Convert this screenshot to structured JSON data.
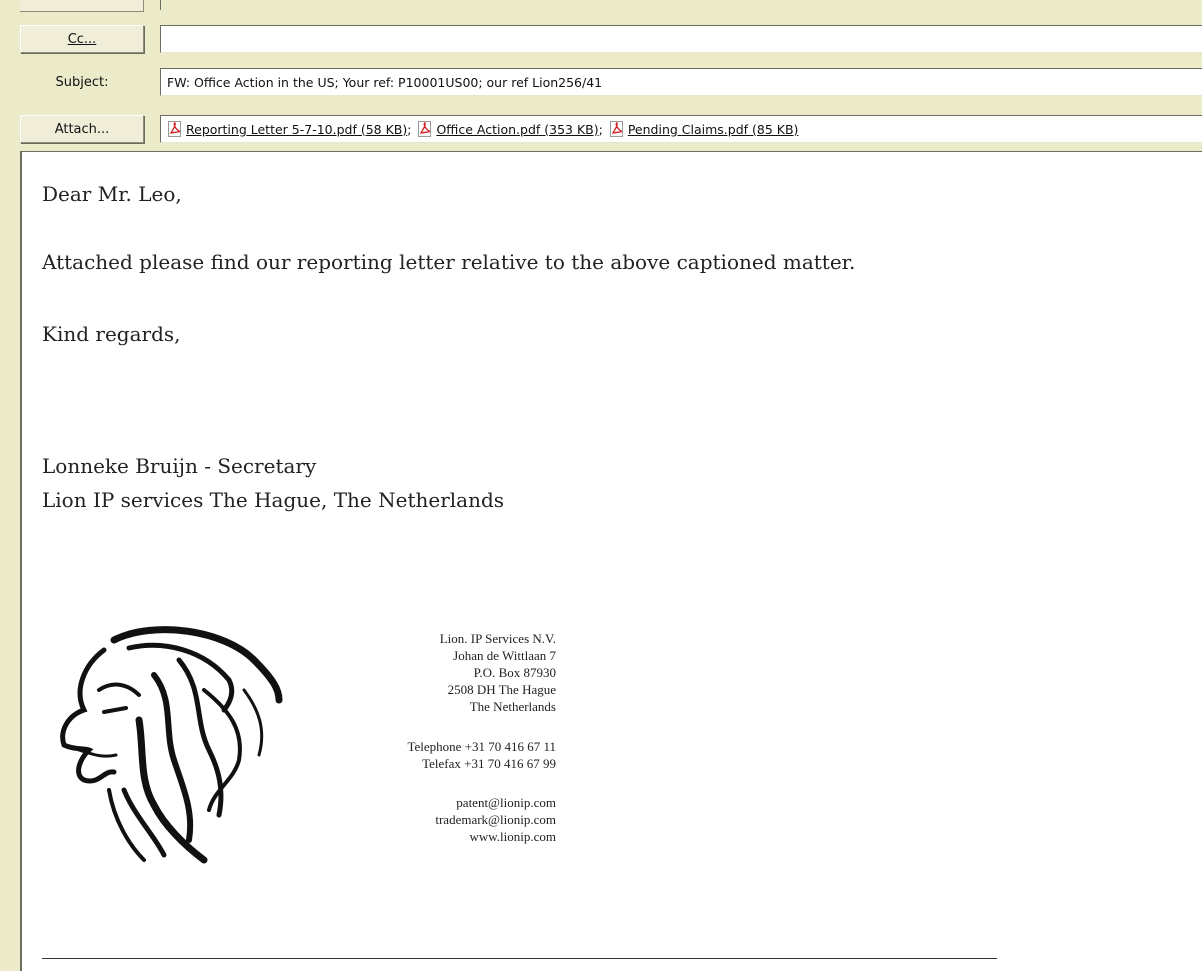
{
  "header": {
    "cc_button": "Cc...",
    "cc_value": "",
    "subject_label": "Subject:",
    "subject_value": "FW: Office Action in the US; Your ref: P10001US00; our ref Lion256/41",
    "attach_button": "Attach...",
    "attachments": [
      {
        "name": "Reporting Letter 5-7-10.pdf (58 KB)",
        "sep": ";",
        "icon": "pdf-icon"
      },
      {
        "name": "Office Action.pdf (353 KB)",
        "sep": ";",
        "icon": "pdf-icon"
      },
      {
        "name": "Pending Claims.pdf (85 KB)",
        "sep": "",
        "icon": "pdf-icon"
      }
    ]
  },
  "body": {
    "greeting": "Dear Mr. Leo,",
    "message": "Attached please find our reporting letter relative to the above captioned matter.",
    "closing": "Kind regards,",
    "sender_name": "Lonneke Bruijn - Secretary",
    "sender_company": "Lion IP services The Hague, The Netherlands"
  },
  "signature": {
    "address_lines": [
      "Lion. IP Services N.V.",
      "Johan de Wittlaan 7",
      "P.O. Box 87930",
      "2508 DH  The Hague",
      "The Netherlands"
    ],
    "phone_lines": [
      "Telephone +31 70 416 67 11",
      "Telefax +31 70 416 67 99"
    ],
    "contact_lines": [
      "patent@lionip.com",
      "trademark@lionip.com",
      "www.lionip.com"
    ],
    "logo_icon": "lion-logo"
  },
  "colors": {
    "chrome": "#ecebc9",
    "pdf_red": "#d11e1e"
  }
}
